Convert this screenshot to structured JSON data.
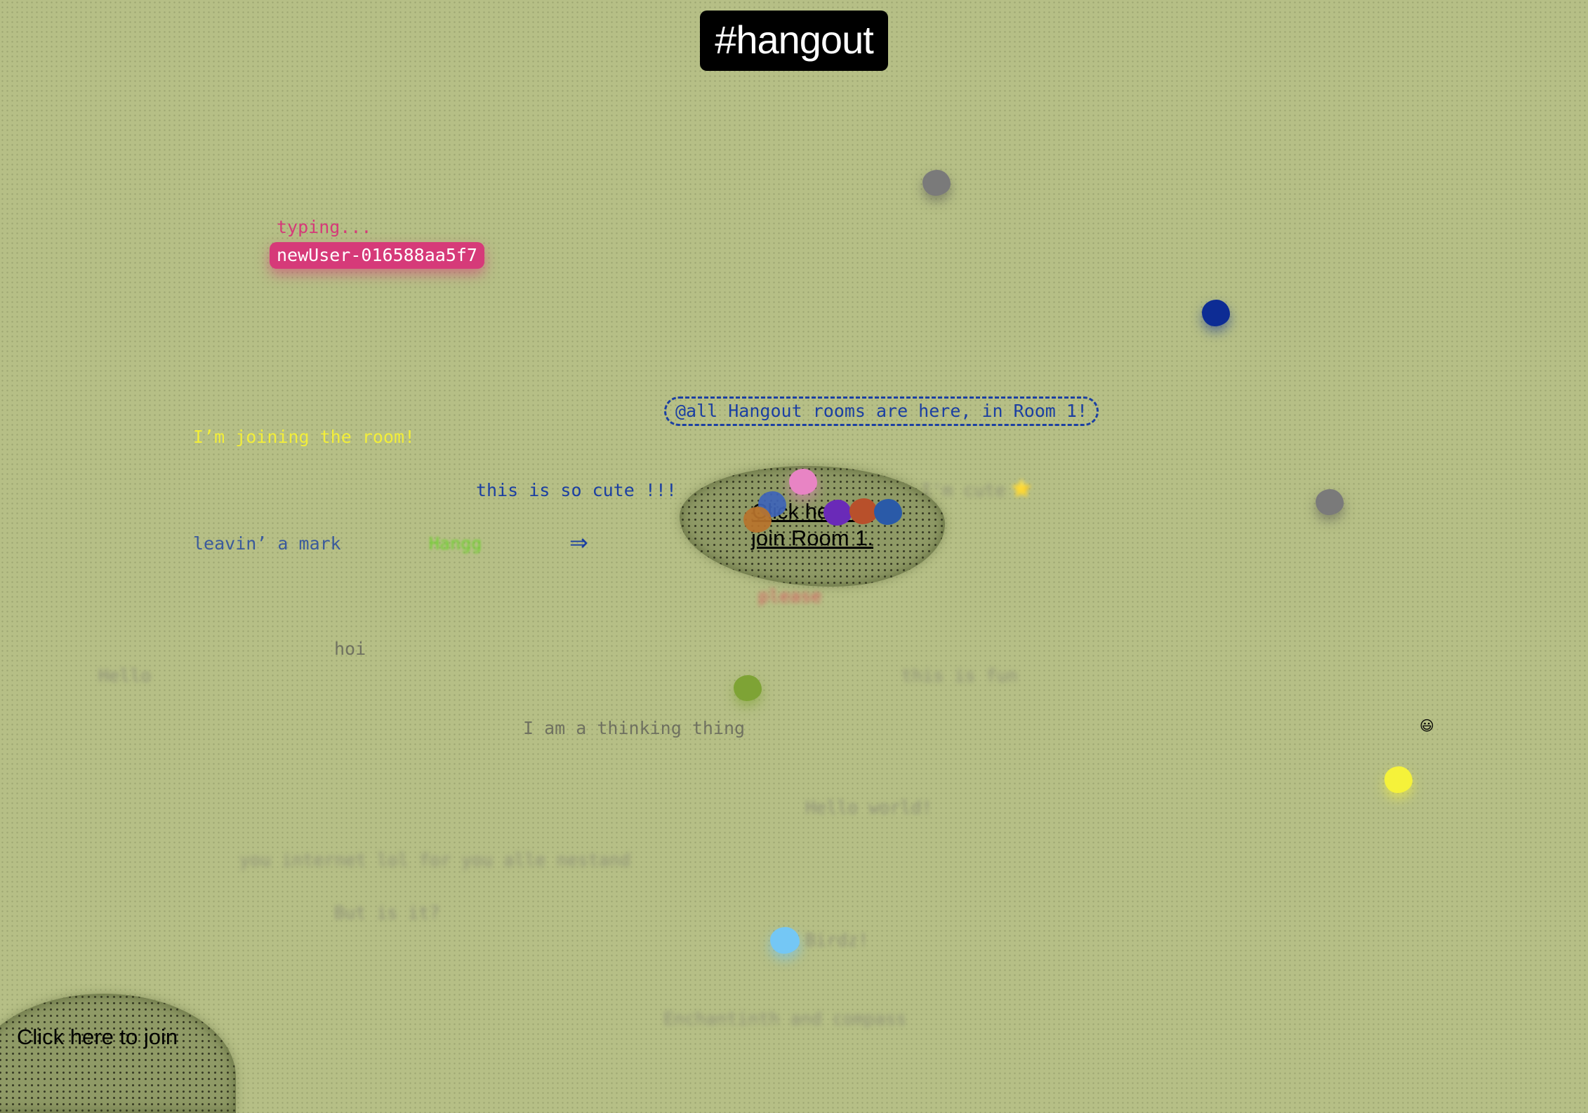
{
  "header": {
    "title": "#hangout"
  },
  "presence": {
    "typing_label": "typing...",
    "username": "newUser-016588aa5f7"
  },
  "announcement": "@all Hangout rooms are here, in Room 1!",
  "rooms": {
    "room1_label": "Click here to join Room 1.",
    "room2_label": "Click here to join"
  },
  "messages": [
    {
      "text": "I’m joining the room!",
      "color": "#f2ee3a"
    },
    {
      "text": "this is so cute !!!",
      "color": "#1b3fa2"
    },
    {
      "text": "leavin’ a mark",
      "color": "#3a5a9c"
    },
    {
      "text": "Hangg",
      "color": "#6bd12a"
    },
    {
      "text": "hoi",
      "color": "#6f7160"
    },
    {
      "text": "Hello",
      "color": "#8f9278"
    },
    {
      "text": "I am a thinking thing",
      "color": "#6f7160"
    },
    {
      "text": "Hello world!",
      "color": "#8f9278"
    },
    {
      "text": "you internet lol for you alle nestand",
      "color": "#8f9278"
    },
    {
      "text": "But is it?",
      "color": "#8f9278"
    },
    {
      "text": "Birdz!",
      "color": "#8f9278"
    },
    {
      "text": "Enchantinth and compass",
      "color": "#8f9278"
    },
    {
      "text": "this is fun",
      "color": "#8f9278"
    },
    {
      "text": "I'm cute",
      "color": "#8f9278"
    },
    {
      "text": "please",
      "color": "#d8545c"
    }
  ],
  "arrow_glyph": "⇒",
  "emoji": "😃",
  "star_emoji": "⭐",
  "cursor_colors": {
    "gray": "#7a7a7a",
    "navy": "#0d2c94",
    "yellow": "#f5f23a",
    "light_blue": "#74c7f5",
    "olive": "#7ea335",
    "pink": "#e884c4",
    "blue": "#3e64b8",
    "brown": "#b8732b",
    "purple": "#6a2ab8",
    "rust": "#b8502b",
    "steel_blue": "#2a5aa8"
  }
}
